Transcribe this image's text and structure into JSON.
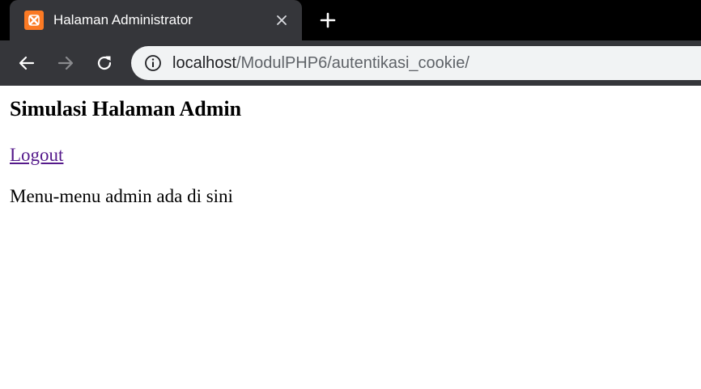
{
  "browser": {
    "tab": {
      "title": "Halaman Administrator",
      "favicon_icon": "xampp-icon",
      "close_icon": "close-icon"
    },
    "new_tab_icon": "plus-icon",
    "toolbar": {
      "back_icon": "arrow-left-icon",
      "forward_icon": "arrow-right-icon",
      "reload_icon": "reload-icon"
    },
    "address_bar": {
      "info_icon": "info-icon",
      "host": "localhost",
      "path": "/ModulPHP6/autentikasi_cookie/"
    },
    "colors": {
      "tabstrip": "#000000",
      "toolbar": "#35363a",
      "omnibox": "#f1f3f4",
      "favicon": "#fb7a24",
      "visited_link": "#551a8b"
    }
  },
  "page": {
    "heading": "Simulasi Halaman Admin",
    "logout_label": "Logout",
    "message": "Menu-menu admin ada di sini"
  }
}
